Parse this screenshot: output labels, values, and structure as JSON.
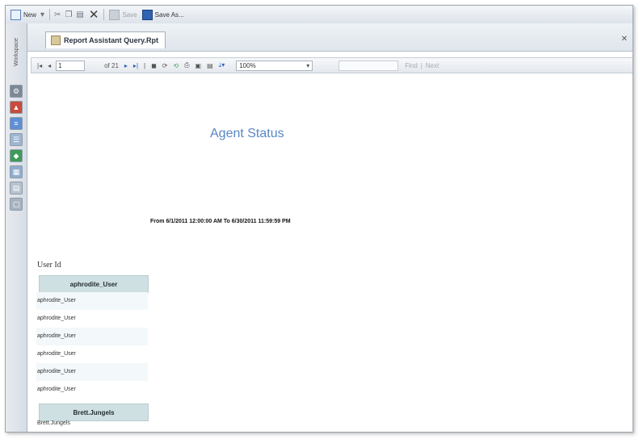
{
  "toolbar": {
    "new_label": "New",
    "save_label": "Save",
    "save_as_label": "Save As..."
  },
  "sidebar": {
    "label": "Workspace",
    "icons": [
      "gear-icon",
      "chart-icon",
      "report-icon",
      "list-icon",
      "refresh-icon",
      "grid-icon",
      "table-icon",
      "document-icon"
    ]
  },
  "document_tab": {
    "title": "Report Assistant Query.Rpt"
  },
  "viewer": {
    "page_current": "1",
    "page_total": "of 21",
    "zoom": "100%",
    "find_label": "Find",
    "next_label": "Next"
  },
  "report": {
    "title": "Agent Status",
    "date_range": "From 6/1/2011 12:00:00 AM  To 6/30/2011 11:59:59 PM",
    "column_label": "User Id",
    "groups": [
      {
        "header": "aphrodite_User",
        "rows": [
          "aphrodite_User",
          "aphrodite_User",
          "aphrodite_User",
          "aphrodite_User",
          "aphrodite_User",
          "aphrodite_User"
        ]
      },
      {
        "header": "Brett.Jungels",
        "rows": [
          "Brett.Jungels"
        ]
      }
    ]
  },
  "colors": {
    "title_blue": "#5a86c7",
    "group_header_bg": "#cfe0e2"
  }
}
